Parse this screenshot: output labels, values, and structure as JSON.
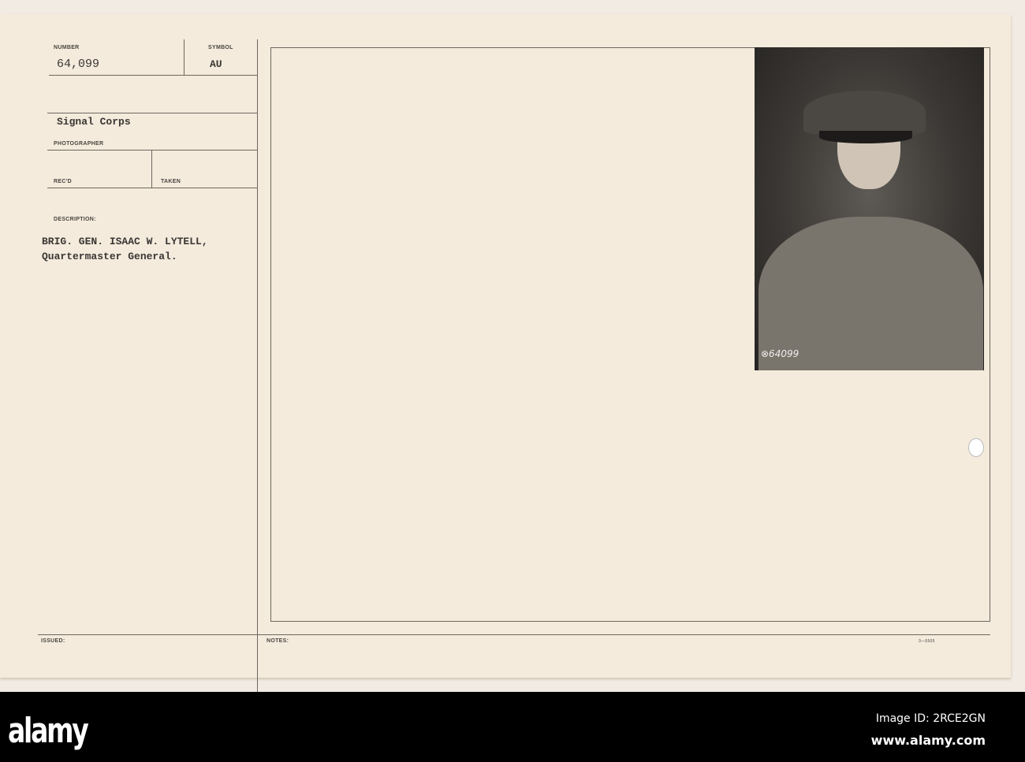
{
  "card": {
    "number_label": "NUMBER",
    "number": "64,099",
    "symbol_label": "SYMBOL",
    "symbol": "AU",
    "source": "Signal Corps",
    "photographer_label": "PHOTOGRAPHER",
    "recd_label": "REC'D",
    "taken_label": "TAKEN",
    "description_label": "DESCRIPTION:",
    "description_line1": "BRIG. GEN. ISAAC W. LYTELL,",
    "description_line2": "Quartermaster General.",
    "issued_label": "ISSUED:",
    "notes_label": "NOTES:",
    "form_code": "3—5505",
    "photo_caption": "⊗64099"
  },
  "footer": {
    "logo": "alamy",
    "image_id": "Image ID: 2RCE2GN",
    "url": "www.alamy.com"
  }
}
